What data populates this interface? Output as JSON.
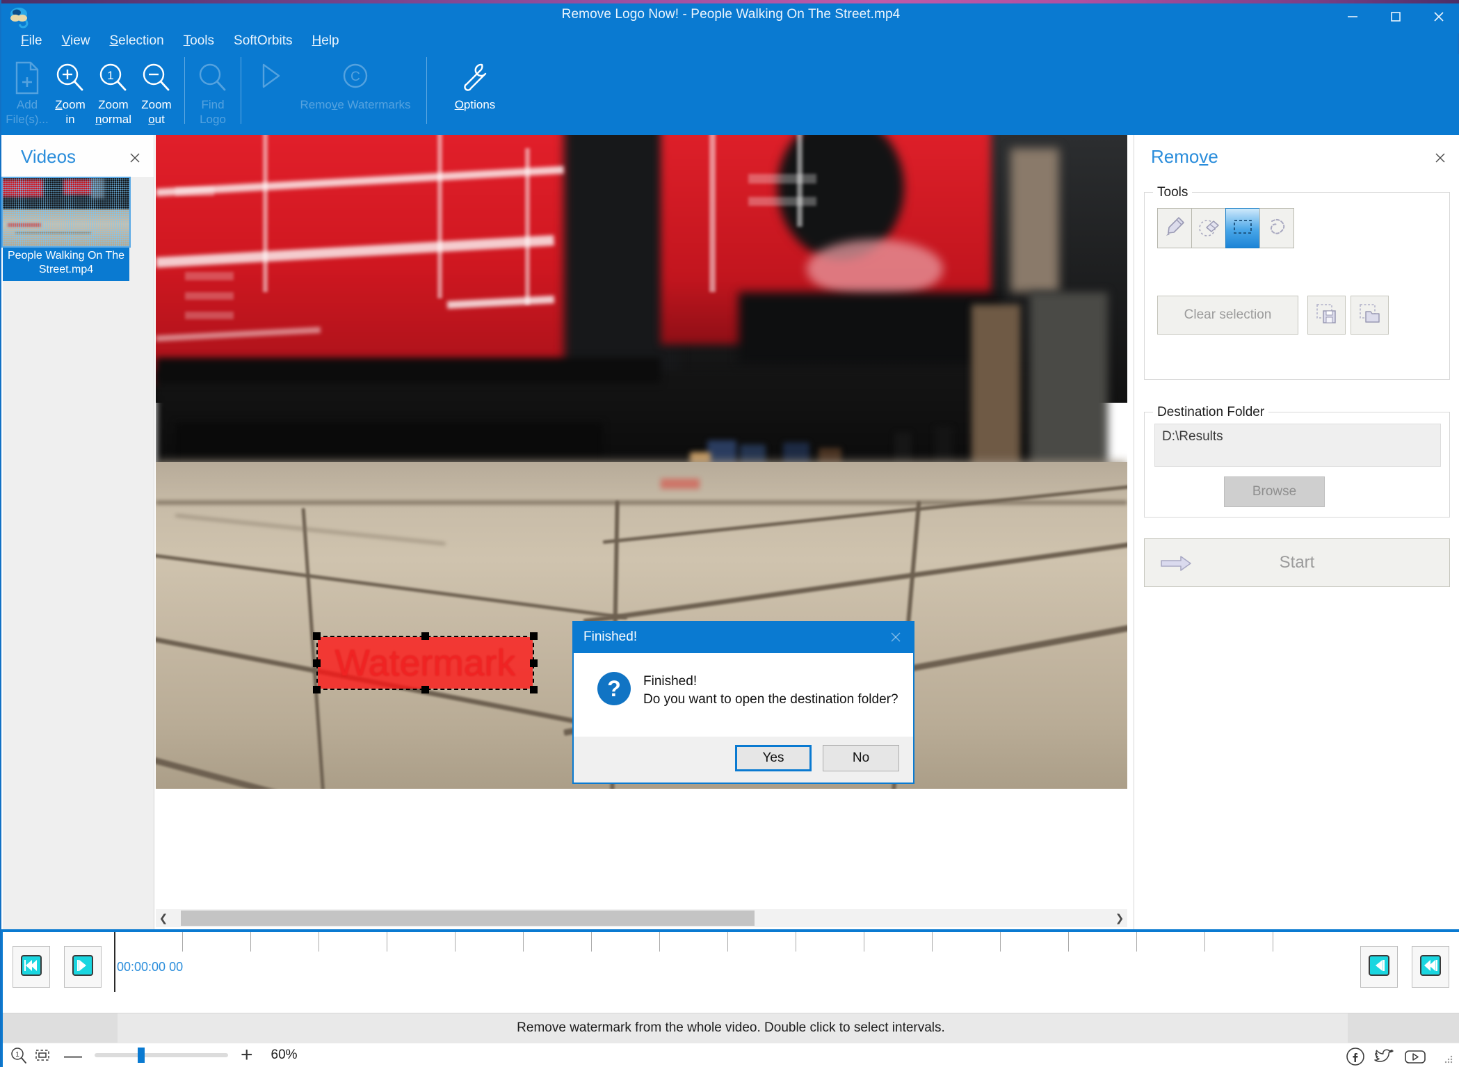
{
  "window": {
    "title": "Remove Logo Now! - People Walking On The Street.mp4",
    "app_icon": "app-logo-icon",
    "minimize": "–",
    "maximize": "□",
    "close": "✕",
    "accent_color": "#0a7ad1"
  },
  "menu": {
    "items": [
      {
        "label": "File",
        "mnemonic": "F"
      },
      {
        "label": "View",
        "mnemonic": "V"
      },
      {
        "label": "Selection",
        "mnemonic": "S"
      },
      {
        "label": "Tools",
        "mnemonic": "T"
      },
      {
        "label": "SoftOrbits",
        "mnemonic": ""
      },
      {
        "label": "Help",
        "mnemonic": "H"
      }
    ]
  },
  "ribbon": {
    "buttons": [
      {
        "id": "add-files",
        "line1": "Add",
        "line2": "File(s)...",
        "icon": "add-file-icon",
        "disabled": true
      },
      {
        "id": "zoom-in",
        "line1": "Zoom",
        "line2": "in",
        "icon": "zoom-in-icon",
        "disabled": false
      },
      {
        "id": "zoom-normal",
        "line1": "Zoom",
        "line2": "normal",
        "icon": "zoom-normal-icon",
        "disabled": false
      },
      {
        "id": "zoom-out",
        "line1": "Zoom",
        "line2": "out",
        "icon": "zoom-out-icon",
        "disabled": false
      },
      {
        "id": "find-logo",
        "line1": "Find",
        "line2": "Logo",
        "icon": "find-logo-icon",
        "disabled": true
      },
      {
        "id": "play",
        "line1": "",
        "line2": "",
        "icon": "play-icon",
        "disabled": true
      },
      {
        "id": "remove-watermarks",
        "line1": "Remove Watermarks",
        "line2": "",
        "icon": "copyright-icon",
        "disabled": true
      },
      {
        "id": "options",
        "line1": "Options",
        "line2": "",
        "icon": "wrench-icon",
        "disabled": false
      }
    ]
  },
  "videos_panel": {
    "title": "Videos",
    "close_icon": "close-icon",
    "items": [
      {
        "label": "People Walking On The Street.mp4",
        "selected": true
      }
    ]
  },
  "preview": {
    "watermark_text": "Watermark",
    "watermark_color": "#ff1414",
    "selection_handles": 8
  },
  "dialog": {
    "title": "Finished!",
    "close_icon": "close-icon",
    "icon": "question-icon",
    "message_line1": "Finished!",
    "message_line2": "Do you want to open the destination folder?",
    "buttons": [
      {
        "id": "yes",
        "label": "Yes",
        "default": true
      },
      {
        "id": "no",
        "label": "No",
        "default": false
      }
    ]
  },
  "remove_panel": {
    "title": "Remove",
    "title_mnemonic": "v",
    "close_icon": "close-icon",
    "tools_group": {
      "title": "Tools",
      "tools": [
        {
          "id": "marker",
          "icon": "marker-pen-icon",
          "active": false
        },
        {
          "id": "eraser",
          "icon": "eraser-icon",
          "active": false
        },
        {
          "id": "rectangle",
          "icon": "rectangle-select-icon",
          "active": true
        },
        {
          "id": "lasso",
          "icon": "lasso-select-icon",
          "active": false
        }
      ],
      "clear_selection_label": "Clear selection",
      "save_selection_icon": "save-selection-icon",
      "load_selection_icon": "load-selection-icon"
    },
    "destination_group": {
      "title": "Destination Folder",
      "path": "D:\\Results",
      "browse_label": "Browse"
    },
    "start_label": "Start",
    "start_icon": "arrow-right-icon"
  },
  "timeline": {
    "first_frame_icon": "skip-to-start-icon",
    "prev_frame_icon": "step-back-icon",
    "next_frame_icon": "step-forward-icon",
    "last_frame_icon": "skip-to-end-icon",
    "timecode": "00:00:00 00",
    "tick_count": 17,
    "playhead_position": 0
  },
  "statusbar": {
    "message": "Remove watermark from the whole video. Double click to select intervals."
  },
  "zoombar": {
    "zoom_normal_icon": "zoom-one-icon",
    "fit_icon": "fit-to-window-icon",
    "minus_label": "—",
    "plus_label": "+",
    "zoom_level": "60%",
    "slider_value": 60,
    "social": [
      {
        "id": "facebook",
        "icon": "facebook-icon"
      },
      {
        "id": "twitter",
        "icon": "twitter-icon"
      },
      {
        "id": "youtube",
        "icon": "youtube-icon"
      }
    ]
  }
}
